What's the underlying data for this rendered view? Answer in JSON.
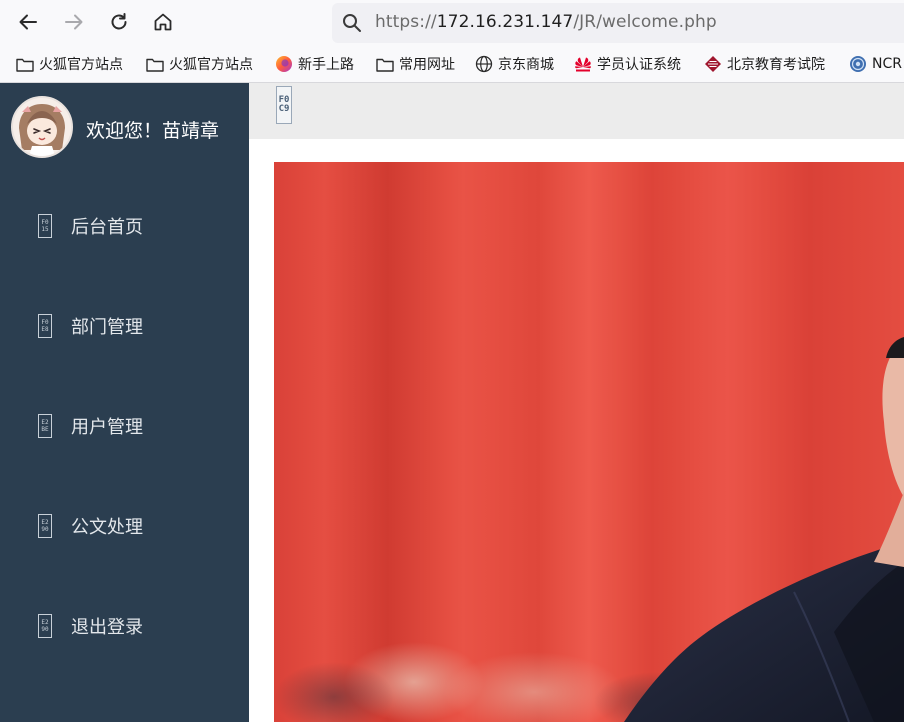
{
  "browser": {
    "url_prefix": "https://",
    "url_host": "172.16.231.147",
    "url_path": "/JR/welcome.php",
    "icons": [
      "back-arrow-icon",
      "forward-arrow-icon",
      "reload-icon",
      "home-icon",
      "search-icon"
    ]
  },
  "bookmarks": [
    {
      "label": "火狐官方站点",
      "icon": "folder-icon"
    },
    {
      "label": "火狐官方站点",
      "icon": "folder-icon"
    },
    {
      "label": "新手上路",
      "icon": "firefox-icon"
    },
    {
      "label": "常用网址",
      "icon": "folder-icon"
    },
    {
      "label": "京东商城",
      "icon": "globe-icon"
    },
    {
      "label": "学员认证系统",
      "icon": "huawei-icon"
    },
    {
      "label": "北京教育考试院",
      "icon": "exam-logo-icon"
    },
    {
      "label": "NCR",
      "icon": "ncre-logo-icon"
    }
  ],
  "sidebar": {
    "welcome_text": "欢迎您！苗靖章",
    "items": [
      {
        "label": "后台首页",
        "glyph_top": "F0",
        "glyph_bottom": "15"
      },
      {
        "label": "部门管理",
        "glyph_top": "F0",
        "glyph_bottom": "E8"
      },
      {
        "label": "用户管理",
        "glyph_top": "E2",
        "glyph_bottom": "BE"
      },
      {
        "label": "公文处理",
        "glyph_top": "E2",
        "glyph_bottom": "90"
      },
      {
        "label": "退出登录",
        "glyph_top": "E2",
        "glyph_bottom": "90"
      }
    ]
  },
  "header": {
    "toggle_glyph_top": "F0",
    "toggle_glyph_bottom": "C9"
  },
  "colors": {
    "sidebar_bg": "#2b3e50",
    "header_bg": "#ececec",
    "photo_red": "#e0403a",
    "suit_navy": "#1e2233"
  }
}
